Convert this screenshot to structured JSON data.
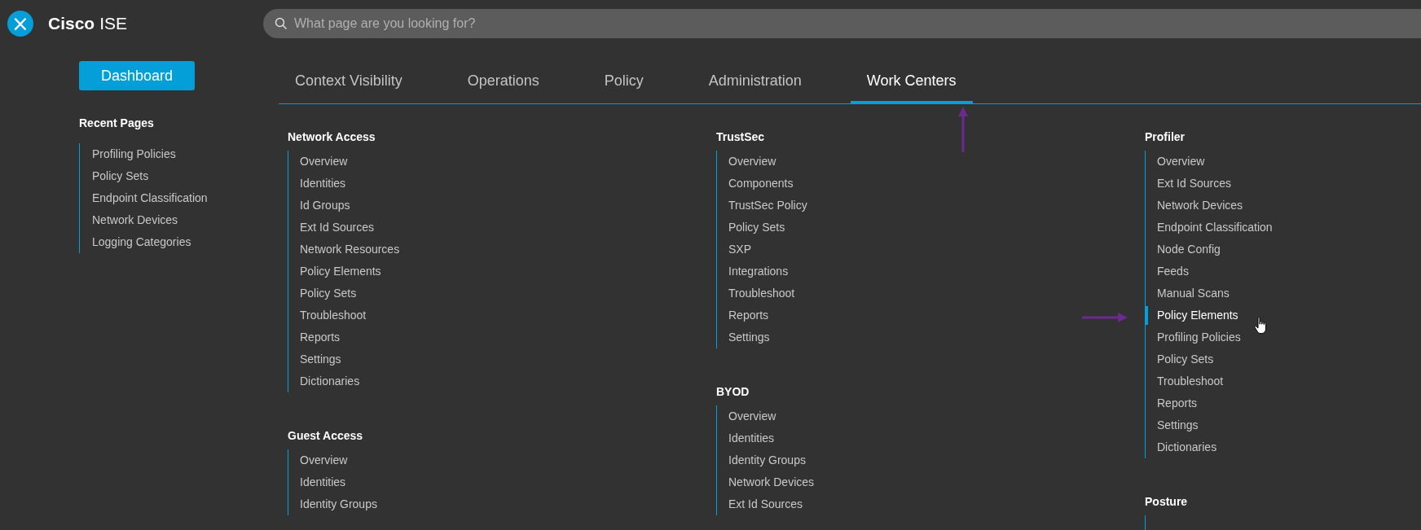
{
  "header": {
    "close_icon": "×",
    "brand_bold": "Cisco",
    "brand": "ISE",
    "search": {
      "placeholder": "What page are you looking for?"
    }
  },
  "sidebar": {
    "dashboard_button": "Dashboard",
    "recent_title": "Recent Pages",
    "recent_pages": [
      "Profiling Policies",
      "Policy Sets",
      "Endpoint Classification",
      "Network Devices",
      "Logging Categories"
    ]
  },
  "tabs": [
    {
      "label": "Context Visibility",
      "selected": false
    },
    {
      "label": "Operations",
      "selected": false
    },
    {
      "label": "Policy",
      "selected": false
    },
    {
      "label": "Administration",
      "selected": false
    },
    {
      "label": "Work Centers",
      "selected": true
    }
  ],
  "columns": [
    {
      "sections": [
        {
          "title": "Network Access",
          "items": [
            {
              "label": "Overview",
              "selected": false
            },
            {
              "label": "Identities",
              "selected": false
            },
            {
              "label": "Id Groups",
              "selected": false
            },
            {
              "label": "Ext Id Sources",
              "selected": false
            },
            {
              "label": "Network Resources",
              "selected": false
            },
            {
              "label": "Policy Elements",
              "selected": false
            },
            {
              "label": "Policy Sets",
              "selected": false
            },
            {
              "label": "Troubleshoot",
              "selected": false
            },
            {
              "label": "Reports",
              "selected": false
            },
            {
              "label": "Settings",
              "selected": false
            },
            {
              "label": "Dictionaries",
              "selected": false
            }
          ]
        },
        {
          "title": "Guest Access",
          "items": [
            {
              "label": "Overview",
              "selected": false
            },
            {
              "label": "Identities",
              "selected": false
            },
            {
              "label": "Identity Groups",
              "selected": false
            }
          ]
        }
      ]
    },
    {
      "sections": [
        {
          "title": "TrustSec",
          "items": [
            {
              "label": "Overview",
              "selected": false
            },
            {
              "label": "Components",
              "selected": false
            },
            {
              "label": "TrustSec Policy",
              "selected": false
            },
            {
              "label": "Policy Sets",
              "selected": false
            },
            {
              "label": "SXP",
              "selected": false
            },
            {
              "label": "Integrations",
              "selected": false
            },
            {
              "label": "Troubleshoot",
              "selected": false
            },
            {
              "label": "Reports",
              "selected": false
            },
            {
              "label": "Settings",
              "selected": false
            }
          ]
        },
        {
          "title": "BYOD",
          "items": [
            {
              "label": "Overview",
              "selected": false
            },
            {
              "label": "Identities",
              "selected": false
            },
            {
              "label": "Identity Groups",
              "selected": false
            },
            {
              "label": "Network Devices",
              "selected": false
            },
            {
              "label": "Ext Id Sources",
              "selected": false
            }
          ]
        }
      ]
    },
    {
      "sections": [
        {
          "title": "Profiler",
          "items": [
            {
              "label": "Overview",
              "selected": false
            },
            {
              "label": "Ext Id Sources",
              "selected": false
            },
            {
              "label": "Network Devices",
              "selected": false
            },
            {
              "label": "Endpoint Classification",
              "selected": false
            },
            {
              "label": "Node Config",
              "selected": false
            },
            {
              "label": "Feeds",
              "selected": false
            },
            {
              "label": "Manual Scans",
              "selected": false
            },
            {
              "label": "Policy Elements",
              "selected": true
            },
            {
              "label": "Profiling Policies",
              "selected": false
            },
            {
              "label": "Policy Sets",
              "selected": false
            },
            {
              "label": "Troubleshoot",
              "selected": false
            },
            {
              "label": "Reports",
              "selected": false
            },
            {
              "label": "Settings",
              "selected": false
            },
            {
              "label": "Dictionaries",
              "selected": false
            }
          ]
        },
        {
          "title": "Posture"
        }
      ]
    }
  ]
}
